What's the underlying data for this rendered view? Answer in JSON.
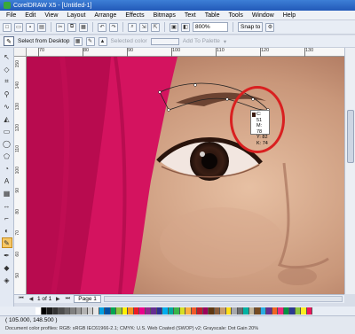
{
  "window": {
    "title": "CorelDRAW X5 - [Untitled-1]"
  },
  "menu": [
    "File",
    "Edit",
    "View",
    "Layout",
    "Arrange",
    "Effects",
    "Bitmaps",
    "Text",
    "Table",
    "Tools",
    "Window",
    "Help"
  ],
  "toolbar": {
    "zoom_value": "800%",
    "snap_label": "Snap to"
  },
  "property_bar": {
    "select_from_desktop": "Select from Desktop",
    "selected_color_label": "Selected color",
    "add_to_palette_label": "Add To Palette"
  },
  "ruler": {
    "h_ticks": [
      "70",
      "80",
      "90",
      "100",
      "110",
      "120",
      "130"
    ],
    "v_ticks": [
      "150",
      "140",
      "130",
      "120",
      "110",
      "100",
      "90",
      "80",
      "70",
      "60",
      "50"
    ],
    "v_unit": "millimeters"
  },
  "color_readout": {
    "c": "C: 51",
    "m": "M: 78",
    "y": "Y: 82",
    "k": "K: 74",
    "swatch_color": "#3a1a10"
  },
  "pages": {
    "counter": "1 of 1",
    "tab_label": "Page 1"
  },
  "palette_colors": [
    "#ffffff",
    "#000000",
    "#1a1a1a",
    "#333333",
    "#4d4d4d",
    "#666666",
    "#808080",
    "#999999",
    "#b3b3b3",
    "#cccccc",
    "#e6e6e6",
    "#00a0e3",
    "#0052a3",
    "#00a651",
    "#8dc63f",
    "#fff200",
    "#f7941d",
    "#ed1c24",
    "#ec008c",
    "#92278f",
    "#662d91",
    "#2e3192",
    "#00aeef",
    "#00a99d",
    "#39b54a",
    "#d7df23",
    "#fbb040",
    "#f15a29",
    "#be1e2d",
    "#9e005d",
    "#603913",
    "#8b5e3c",
    "#c69c6d",
    "#ffde17",
    "#a7a9ac",
    "#6d6e71",
    "#00b3a4",
    "#c2b59b",
    "#754c24",
    "#29abe2",
    "#662d91",
    "#f26522",
    "#ee2a7b",
    "#009444",
    "#2b3990",
    "#8cc63f",
    "#fcee21",
    "#ed145b"
  ],
  "status": {
    "coords": "( 105.000, 148.500 )",
    "profile": "Document color profiles: RGB: sRGB IEC61966-2.1; CMYK: U.S. Web Coated (SWOP) v2; Grayscale: Dot Gain 20%"
  }
}
